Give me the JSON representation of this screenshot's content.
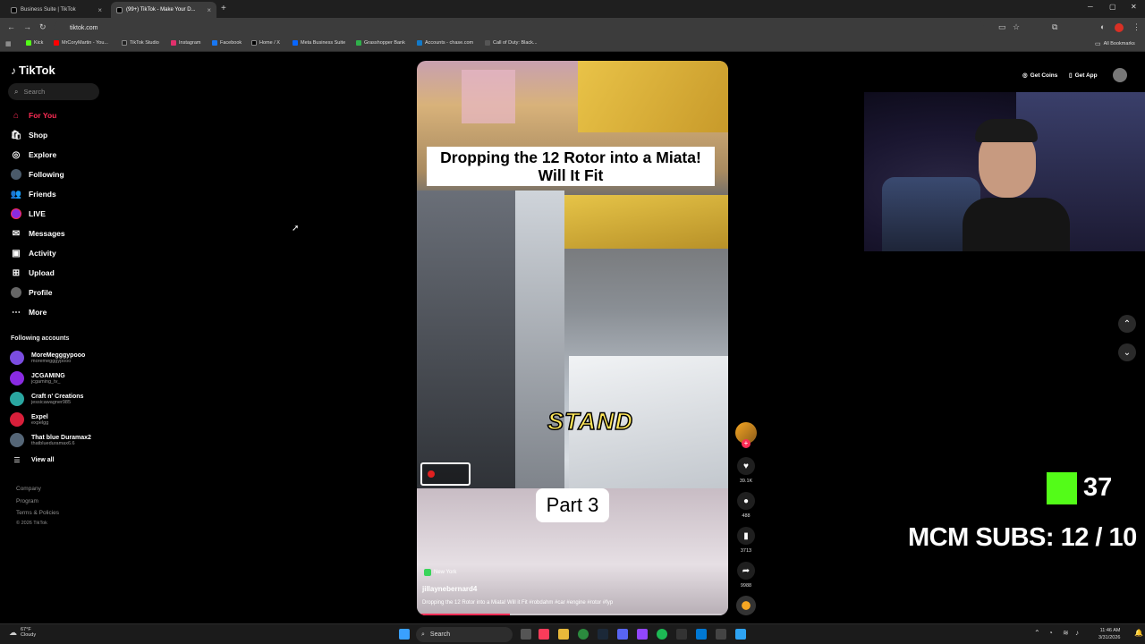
{
  "browser": {
    "tabs": [
      {
        "title": "Business Suite | TikTok",
        "active": false
      },
      {
        "title": "(99+) TikTok - Make Your D...",
        "active": true
      }
    ],
    "new_tab": "+",
    "url": "tiktok.com",
    "bookmarks": [
      {
        "label": "Kick",
        "color": "#53fc18"
      },
      {
        "label": "MrCoryMartin - You...",
        "color": "#ff0000"
      },
      {
        "label": "TikTok Studio",
        "color": "#000000"
      },
      {
        "label": "Instagram",
        "color": "#e1306c"
      },
      {
        "label": "Facebook",
        "color": "#1877f2"
      },
      {
        "label": "Home / X",
        "color": "#000000"
      },
      {
        "label": "Meta Business Suite",
        "color": "#0866ff"
      },
      {
        "label": "Grasshopper Bank",
        "color": "#2fb04a"
      },
      {
        "label": "Accounts - chase.com",
        "color": "#117aca"
      },
      {
        "label": "Call of Duty: Black...",
        "color": "#444444"
      }
    ],
    "all_bookmarks": "All Bookmarks"
  },
  "sidebar": {
    "logo": "TikTok",
    "search_placeholder": "Search",
    "nav": [
      {
        "label": "For You",
        "icon": "home-icon",
        "active": true
      },
      {
        "label": "Shop",
        "icon": "shop-icon"
      },
      {
        "label": "Explore",
        "icon": "compass-icon"
      },
      {
        "label": "Following",
        "icon": "following-icon"
      },
      {
        "label": "Friends",
        "icon": "friends-icon"
      },
      {
        "label": "LIVE",
        "icon": "live-icon"
      },
      {
        "label": "Messages",
        "icon": "messages-icon"
      },
      {
        "label": "Activity",
        "icon": "activity-icon"
      },
      {
        "label": "Upload",
        "icon": "upload-icon"
      },
      {
        "label": "Profile",
        "icon": "profile-icon"
      },
      {
        "label": "More",
        "icon": "more-icon"
      }
    ],
    "following_title": "Following accounts",
    "accounts": [
      {
        "name": "MoreMegggypooo",
        "handle": "moremegggypooo",
        "color": "#7b4de0"
      },
      {
        "name": "JCGAMING",
        "handle": "jcgaming_tv_",
        "color": "#8a2be2"
      },
      {
        "name": "Craft n' Creations",
        "handle": "jessicawagner985",
        "color": "#2aa6a0"
      },
      {
        "name": "Expel",
        "handle": "expelgg",
        "color": "#d81f3a"
      },
      {
        "name": "That blue Duramax2",
        "handle": "thatblueduramax6.6",
        "color": "#556677"
      }
    ],
    "view_all": "View all",
    "footer": [
      "Company",
      "Program",
      "Terms & Policies",
      "© 2026 TikTok"
    ]
  },
  "video": {
    "title_line1": "Dropping the 12 Rotor into a Miata!",
    "title_line2": "Will It Fit",
    "overlay_word": "STAND",
    "part": "Part 3",
    "location": "New York",
    "username": "jillaynebernard4",
    "description": "Dropping the 12 Rotor into a Miata! Will it Fit #robdahm #car #engine #rotor #fyp",
    "progress": 0.3
  },
  "actions": {
    "likes": "39.1K",
    "comments": "488",
    "saves": "3713",
    "shares": "9988"
  },
  "topright": {
    "get_coins": "Get Coins",
    "get_app": "Get App"
  },
  "stream_overlay": {
    "kick_count": "37",
    "subs_text": "MCM SUBS:  12 / 10"
  },
  "taskbar": {
    "weather_temp": "67°F",
    "weather_desc": "Cloudy",
    "search": "Search",
    "time": "11:46 AM",
    "date": "3/31/2026"
  }
}
